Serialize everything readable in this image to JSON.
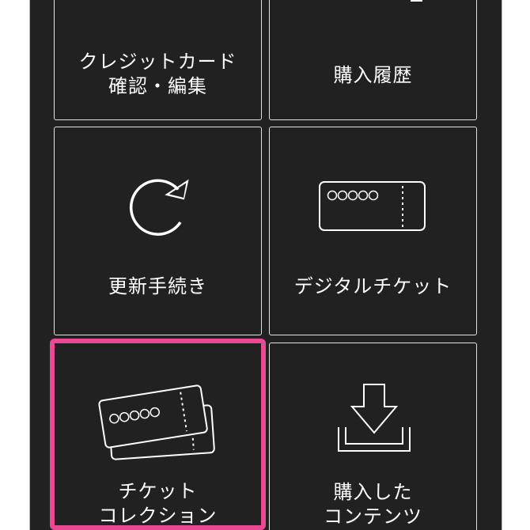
{
  "menu": {
    "credit_card": {
      "line1": "クレジットカード",
      "line2": "確認・編集",
      "icon": "credit-card-icon"
    },
    "purchase_history": {
      "line1": "購入履歴",
      "icon": "hand-icon"
    },
    "renewal": {
      "line1": "更新手続き",
      "icon": "refresh-icon"
    },
    "digital_ticket": {
      "line1": "デジタルチケット",
      "icon": "ticket-icon"
    },
    "ticket_collection": {
      "line1": "チケット",
      "line2": "コレクション",
      "icon": "ticket-stack-icon",
      "selected": true
    },
    "purchased_contents": {
      "line1": "購入した",
      "line2": "コンテンツ",
      "icon": "download-icon"
    }
  },
  "colors": {
    "background": "#212121",
    "border": "#e2e2e2",
    "highlight": "#ea4a93",
    "text": "#ffffff"
  }
}
